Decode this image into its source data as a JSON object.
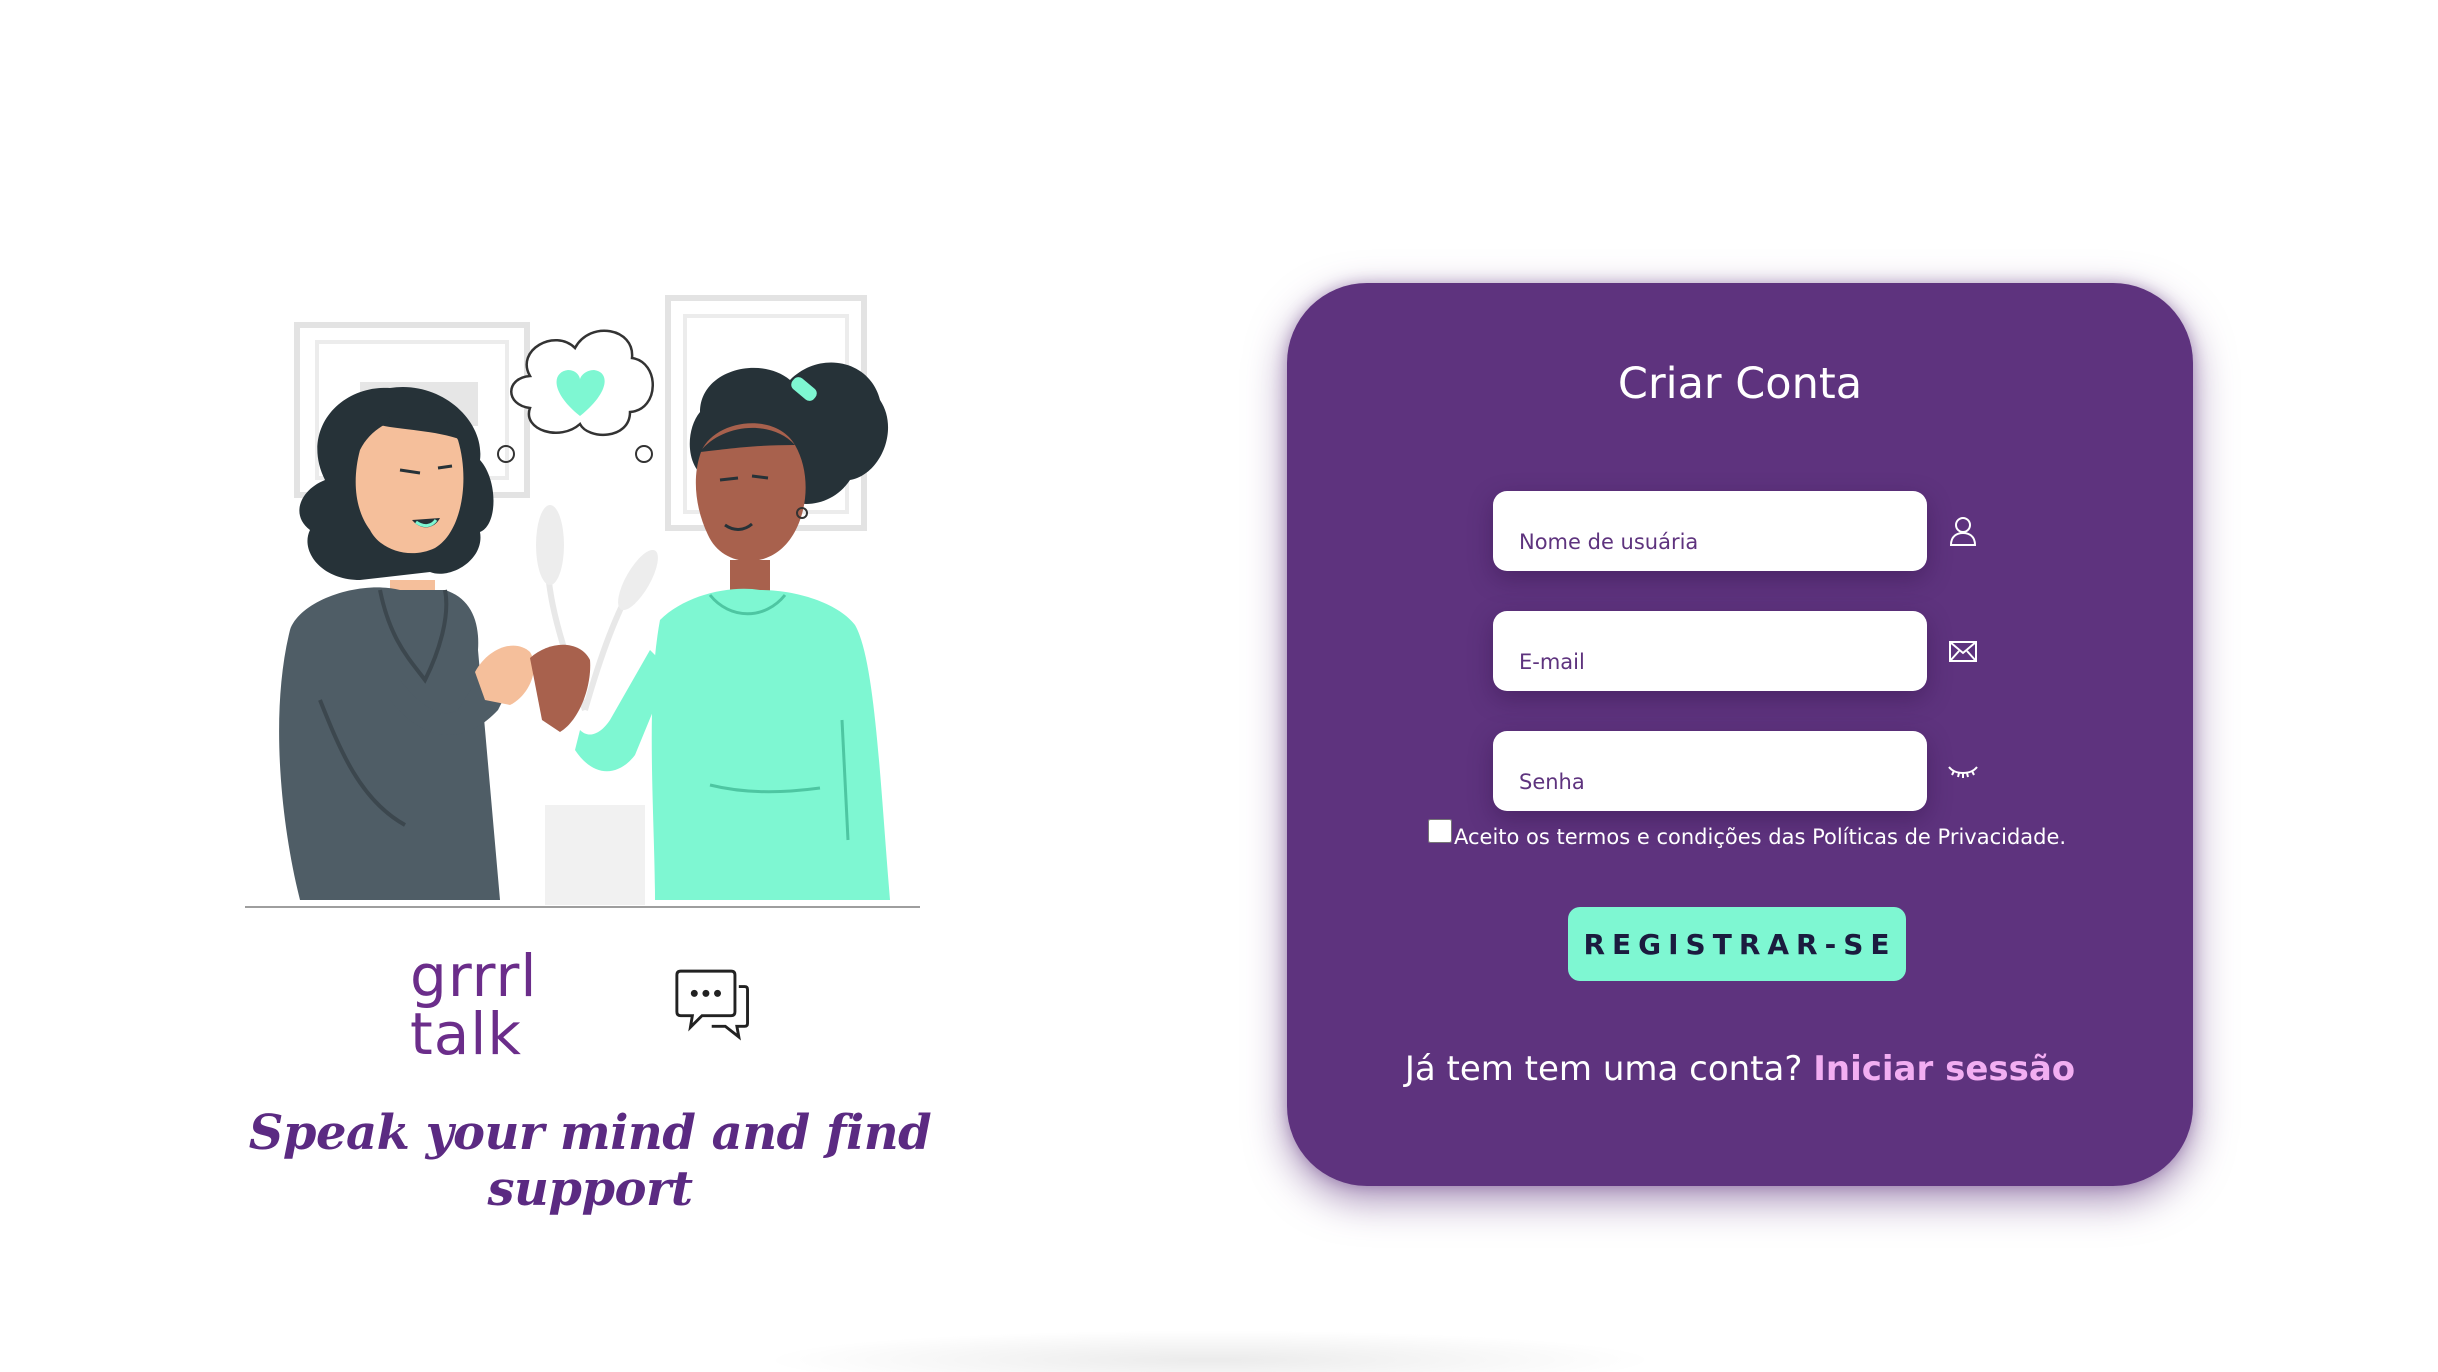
{
  "brand": {
    "name": "grrrl talk",
    "tagline": "Speak your mind and find support"
  },
  "signup": {
    "title": "Criar Conta",
    "username_placeholder": "Nome de usuária",
    "email_placeholder": "E-mail",
    "password_placeholder": "Senha",
    "terms_label": "Aceito os termos e condições das Políticas de Privacidade.",
    "terms_checked": false,
    "register_label": "REGISTRAR-SE",
    "login_prompt": "Já tem tem uma conta?",
    "login_link": "Iniciar sessão"
  },
  "icons": {
    "username": "user-icon",
    "email": "envelope-icon",
    "password": "eye-closed-icon",
    "brand": "chat-bubbles-icon"
  },
  "colors": {
    "card": "#5e337e",
    "accent_button": "#7ef7d2",
    "link": "#f2aef2",
    "brand_purple": "#6b2d8a"
  }
}
